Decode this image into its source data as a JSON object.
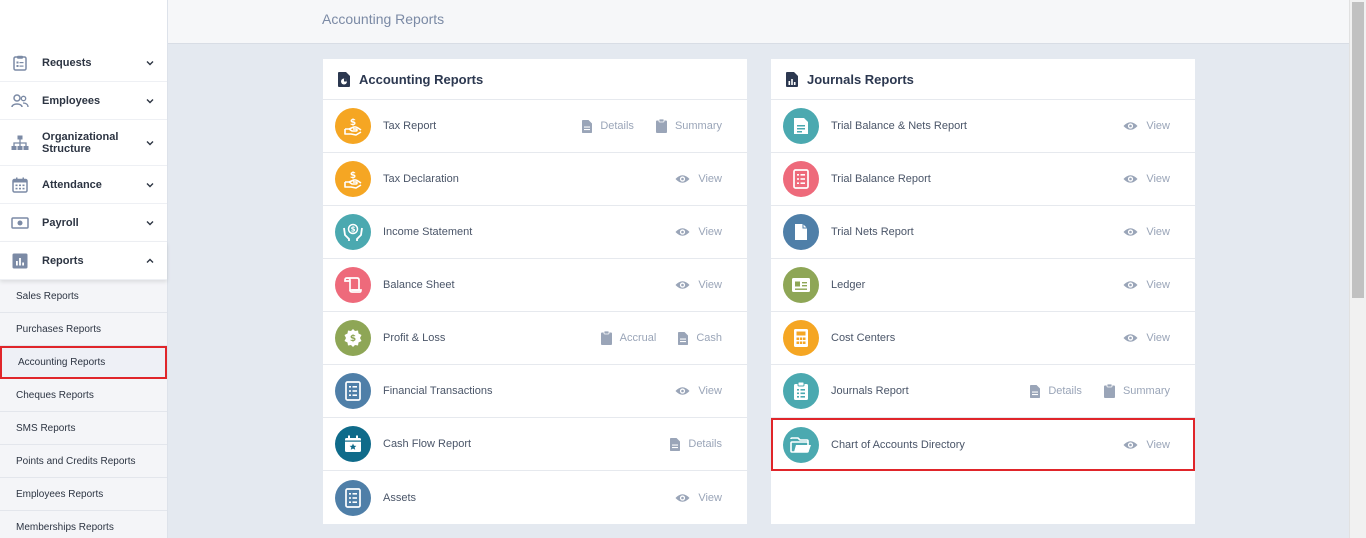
{
  "header": {
    "title": "Accounting Reports"
  },
  "sidebar": {
    "items": [
      {
        "label": "Requests"
      },
      {
        "label": "Employees"
      },
      {
        "label": "Organizational Structure"
      },
      {
        "label": "Attendance"
      },
      {
        "label": "Payroll"
      },
      {
        "label": "Reports"
      }
    ],
    "sub_items": [
      {
        "label": "Sales Reports"
      },
      {
        "label": "Purchases Reports"
      },
      {
        "label": "Accounting Reports",
        "active": true
      },
      {
        "label": "Cheques Reports"
      },
      {
        "label": "SMS Reports"
      },
      {
        "label": "Points and Credits Reports"
      },
      {
        "label": "Employees Reports"
      },
      {
        "label": "Memberships Reports"
      }
    ]
  },
  "accounting_card": {
    "title": "Accounting Reports",
    "rows": [
      {
        "label": "Tax Report",
        "color": "#f5a623",
        "icon": "hand-dollar-icon",
        "actions": [
          "Details",
          "Summary"
        ]
      },
      {
        "label": "Tax Declaration",
        "color": "#f5a623",
        "icon": "hand-dollar-icon",
        "actions": [
          "View"
        ]
      },
      {
        "label": "Income Statement",
        "color": "#4ba9b0",
        "icon": "hands-coin-icon",
        "actions": [
          "View"
        ]
      },
      {
        "label": "Balance Sheet",
        "color": "#ee6a7b",
        "icon": "scroll-icon",
        "actions": [
          "View"
        ]
      },
      {
        "label": "Profit & Loss",
        "color": "#8ea656",
        "icon": "coin-badge-icon",
        "actions": [
          "Accrual",
          "Cash"
        ]
      },
      {
        "label": "Financial Transactions",
        "color": "#4f7fa8",
        "icon": "list-doc-icon",
        "actions": [
          "View"
        ]
      },
      {
        "label": "Cash Flow Report",
        "color": "#0f6b8a",
        "icon": "calendar-star-icon",
        "actions": [
          "Details"
        ]
      },
      {
        "label": "Assets",
        "color": "#4f7fa8",
        "icon": "list-doc-icon",
        "actions": [
          "View"
        ]
      }
    ]
  },
  "journals_card": {
    "title": "Journals Reports",
    "rows": [
      {
        "label": "Trial Balance & Nets Report",
        "color": "#4ba9b0",
        "icon": "doc-lines-icon",
        "actions": [
          "View"
        ]
      },
      {
        "label": "Trial Balance Report",
        "color": "#ee6a7b",
        "icon": "list-doc-icon",
        "actions": [
          "View"
        ]
      },
      {
        "label": "Trial Nets Report",
        "color": "#4f7fa8",
        "icon": "doc-icon",
        "actions": [
          "View"
        ]
      },
      {
        "label": "Ledger",
        "color": "#8ea656",
        "icon": "id-card-icon",
        "actions": [
          "View"
        ]
      },
      {
        "label": "Cost Centers",
        "color": "#f5a623",
        "icon": "calculator-icon",
        "actions": [
          "View"
        ]
      },
      {
        "label": "Journals Report",
        "color": "#4ba9b0",
        "icon": "clipboard-list-icon",
        "actions": [
          "Details",
          "Summary"
        ]
      },
      {
        "label": "Chart of Accounts Directory",
        "color": "#4ba9b0",
        "icon": "folder-icon",
        "actions": [
          "View"
        ],
        "highlight": true
      }
    ]
  }
}
